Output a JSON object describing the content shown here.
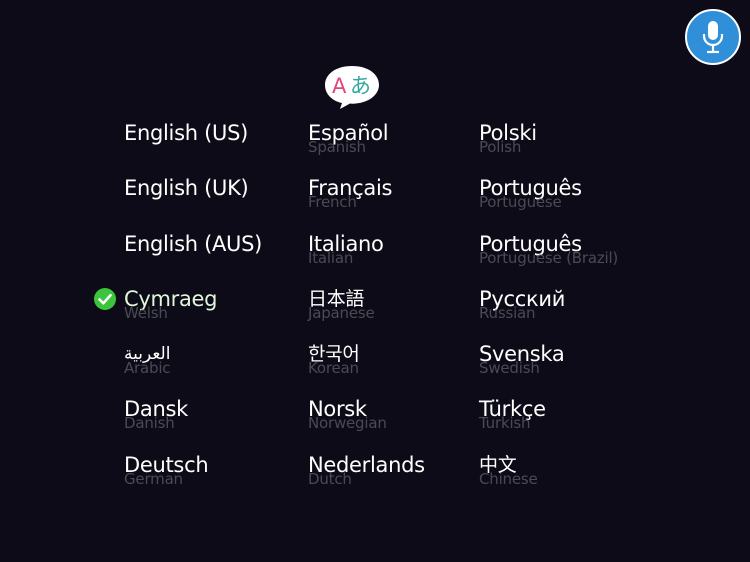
{
  "colors": {
    "background": "#0d0b17",
    "native_text": "#ffffff",
    "english_text": "#4a4a55",
    "mic_button": "#2f8fd8",
    "check": "#3cc43c"
  },
  "icons": {
    "mic": "microphone-icon",
    "header": "translate-icon",
    "selected": "checkmark-circle-icon"
  },
  "header_icon": {
    "latin": "A",
    "japanese": "あ"
  },
  "selected_language": "Cymraeg",
  "columns": [
    [
      {
        "native": "English (US)",
        "english": ""
      },
      {
        "native": "English (UK)",
        "english": ""
      },
      {
        "native": "English (AUS)",
        "english": ""
      },
      {
        "native": "Cymraeg",
        "english": "Welsh"
      },
      {
        "native": "العربية",
        "english": "Arabic"
      },
      {
        "native": "Dansk",
        "english": "Danish"
      },
      {
        "native": "Deutsch",
        "english": "German"
      }
    ],
    [
      {
        "native": "Español",
        "english": "Spanish"
      },
      {
        "native": "Français",
        "english": "French"
      },
      {
        "native": "Italiano",
        "english": "Italian"
      },
      {
        "native": "日本語",
        "english": "Japanese"
      },
      {
        "native": "한국어",
        "english": "Korean"
      },
      {
        "native": "Norsk",
        "english": "Norwegian"
      },
      {
        "native": "Nederlands",
        "english": "Dutch"
      }
    ],
    [
      {
        "native": "Polski",
        "english": "Polish"
      },
      {
        "native": "Português",
        "english": "Portuguese"
      },
      {
        "native": "Português",
        "english": "Portuguese (Brazil)"
      },
      {
        "native": "Русский",
        "english": "Russian"
      },
      {
        "native": "Svenska",
        "english": "Swedish"
      },
      {
        "native": "Türkçe",
        "english": "Turkish"
      },
      {
        "native": "中文",
        "english": "Chinese"
      }
    ]
  ]
}
